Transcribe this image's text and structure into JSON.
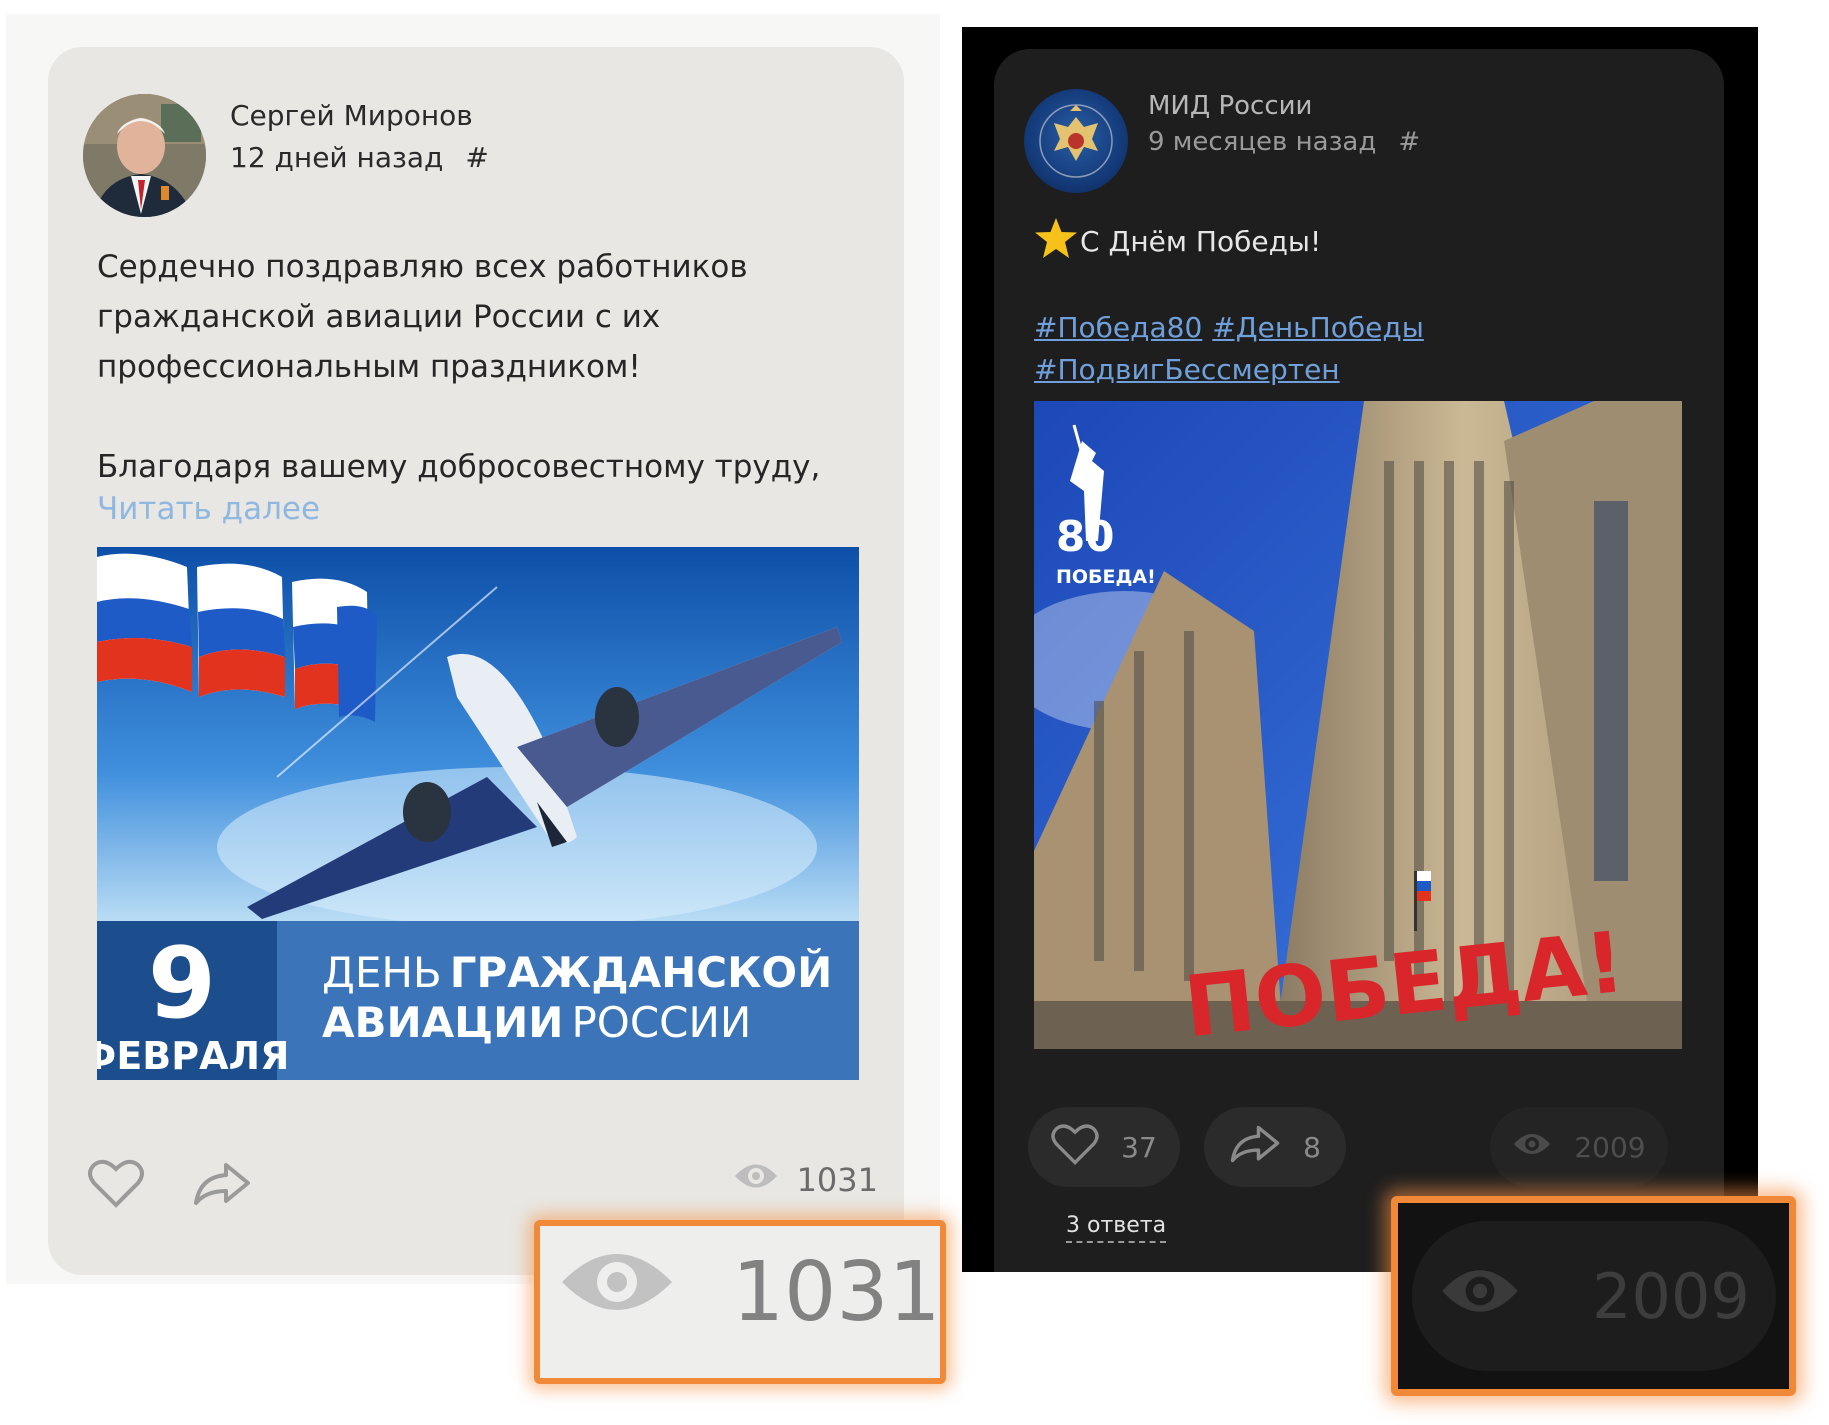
{
  "light_post": {
    "author": "Сергей Миронов",
    "time": "12 дней назад",
    "hash": "#",
    "text_p1": "Сердечно поздравляю всех работников гражданской авиации России с их профессиональным праздником!",
    "text_p2": "Благодаря вашему добросовестному труду,",
    "read_more": "Читать далее",
    "image": {
      "day": "9",
      "month": "ФЕВРАЛЯ",
      "line1_light": "ДЕНЬ",
      "line1_bold": "ГРАЖДАНСКОЙ",
      "line2_bold": "АВИАЦИИ",
      "line2_light": "РОССИИ"
    },
    "views": "1031"
  },
  "zoom_light": {
    "views": "1031"
  },
  "dark_post": {
    "author": "МИД России",
    "time": "9 месяцев назад",
    "hash": "#",
    "text": "С Днём Победы!",
    "tags": [
      "#Победа80",
      "#ДеньПобеды",
      "#ПодвигБессмертен"
    ],
    "image": {
      "logo_number": "80",
      "logo_text": "ПОБЕДА!",
      "banner": "ПОБЕДА!"
    },
    "likes": "37",
    "shares": "8",
    "views": "2009",
    "replies": "3 ответа"
  },
  "zoom_dark": {
    "views": "2009"
  },
  "colors": {
    "highlight": "#f08a38",
    "light_card": "#e8e7e3",
    "dark_card": "#1e1e1e",
    "link_light": "#8fb8e0",
    "link_dark": "#6fa0db"
  }
}
